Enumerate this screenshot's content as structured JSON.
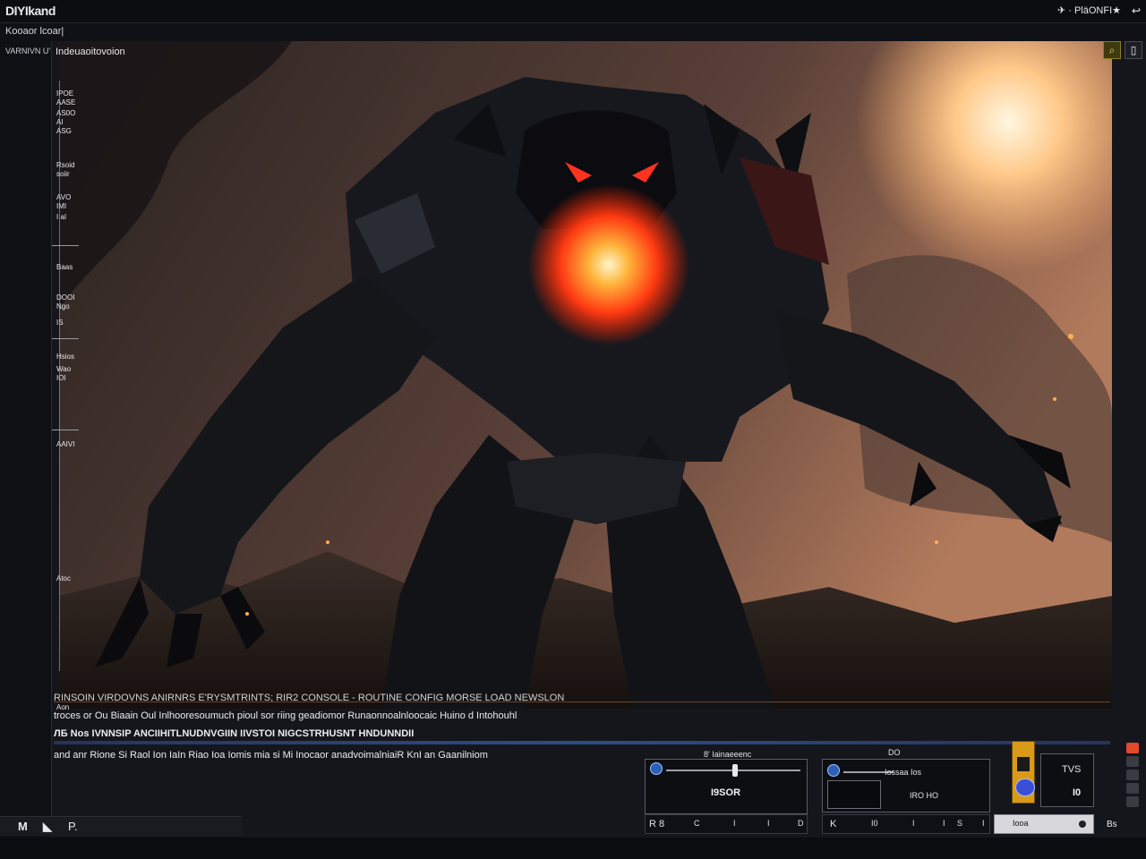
{
  "topbar": {
    "app_name": "DIYIkand",
    "right_icons_text": "✈ · PläONFI★",
    "corner_icon": "↩"
  },
  "breadcrumb": {
    "text": "Kooaor lcoar|"
  },
  "left_rail": {
    "title": "VARNIVN U'"
  },
  "viewport": {
    "title": "Indeuaoitovoion"
  },
  "panel_items": [
    {
      "l1": "IPOE",
      "l2": "AASE"
    },
    {
      "l1": "AS0O",
      "l2": "AI"
    },
    {
      "l1": "ASG",
      "l2": ""
    },
    {
      "l1": "Rsoid",
      "l2": "soiir"
    },
    {
      "l1": "AVO",
      "l2": "IMI"
    },
    {
      "l1": "I aI",
      "l2": ""
    },
    {
      "l1": "Baas",
      "l2": ""
    },
    {
      "l1": "DOOI",
      "l2": "Ngo"
    },
    {
      "l1": "IS",
      "l2": ""
    },
    {
      "l1": "Hsios",
      "l2": ""
    },
    {
      "l1": "Wao",
      "l2": "IOI"
    },
    {
      "l1": "AAIVI",
      "l2": ""
    },
    {
      "l1": "Atoc",
      "l2": ""
    },
    {
      "l1": "Aon",
      "l2": ""
    }
  ],
  "right_tools": [
    {
      "name": "search-tool-button",
      "glyph": "⌕",
      "accent": true
    },
    {
      "name": "phone-tool-button",
      "glyph": "▯",
      "accent": false
    }
  ],
  "log": {
    "row1": "RINSOIN VIRDOVNS ANIRNRS E'RYSMTRINTS; RIR2 CONSOLE - ROUTINE CONFIG MORSE LOAD NEWSLON",
    "row2": "troces or Ou Biaain  Oul Inlhooresoumuch pioul sor riing geadiomor Runaonnoalnloocaic Huino d Intohouhl",
    "row3": "ЛБ Nos IVNNSIP      ANCIIHITLNUDNVGIIN IIVSTOI NIGCSTRHUSNT HNDUNNDII",
    "row4": "and anr Rione Si Raol Ion IaIn Riao Ioa Iomis mia si Mi Inocaor anadvoimalniaiR KnI an Gaanilniom"
  },
  "hud": {
    "panel_a": {
      "title": "8' Iainaeeenc",
      "value": "I9SOR",
      "bottom": [
        "R  8",
        "C",
        "I",
        "I",
        "D"
      ]
    },
    "panel_b": {
      "top": "DO",
      "label": "Iossaa Ios",
      "value": "IRO HO",
      "bottom": [
        "K",
        "I0",
        "I",
        "I",
        "S",
        "I"
      ]
    },
    "panel_c": {
      "label1": "TVS",
      "label2": "I0",
      "badge": "Iooa"
    },
    "right_tiny": "Bs"
  },
  "bottom_bar": {
    "btn1": "M",
    "btn2": "◣",
    "btn3": "P."
  },
  "colors": {
    "accent": "#ffd23a",
    "bg": "#15161b",
    "glow": "#ff5a1e"
  }
}
